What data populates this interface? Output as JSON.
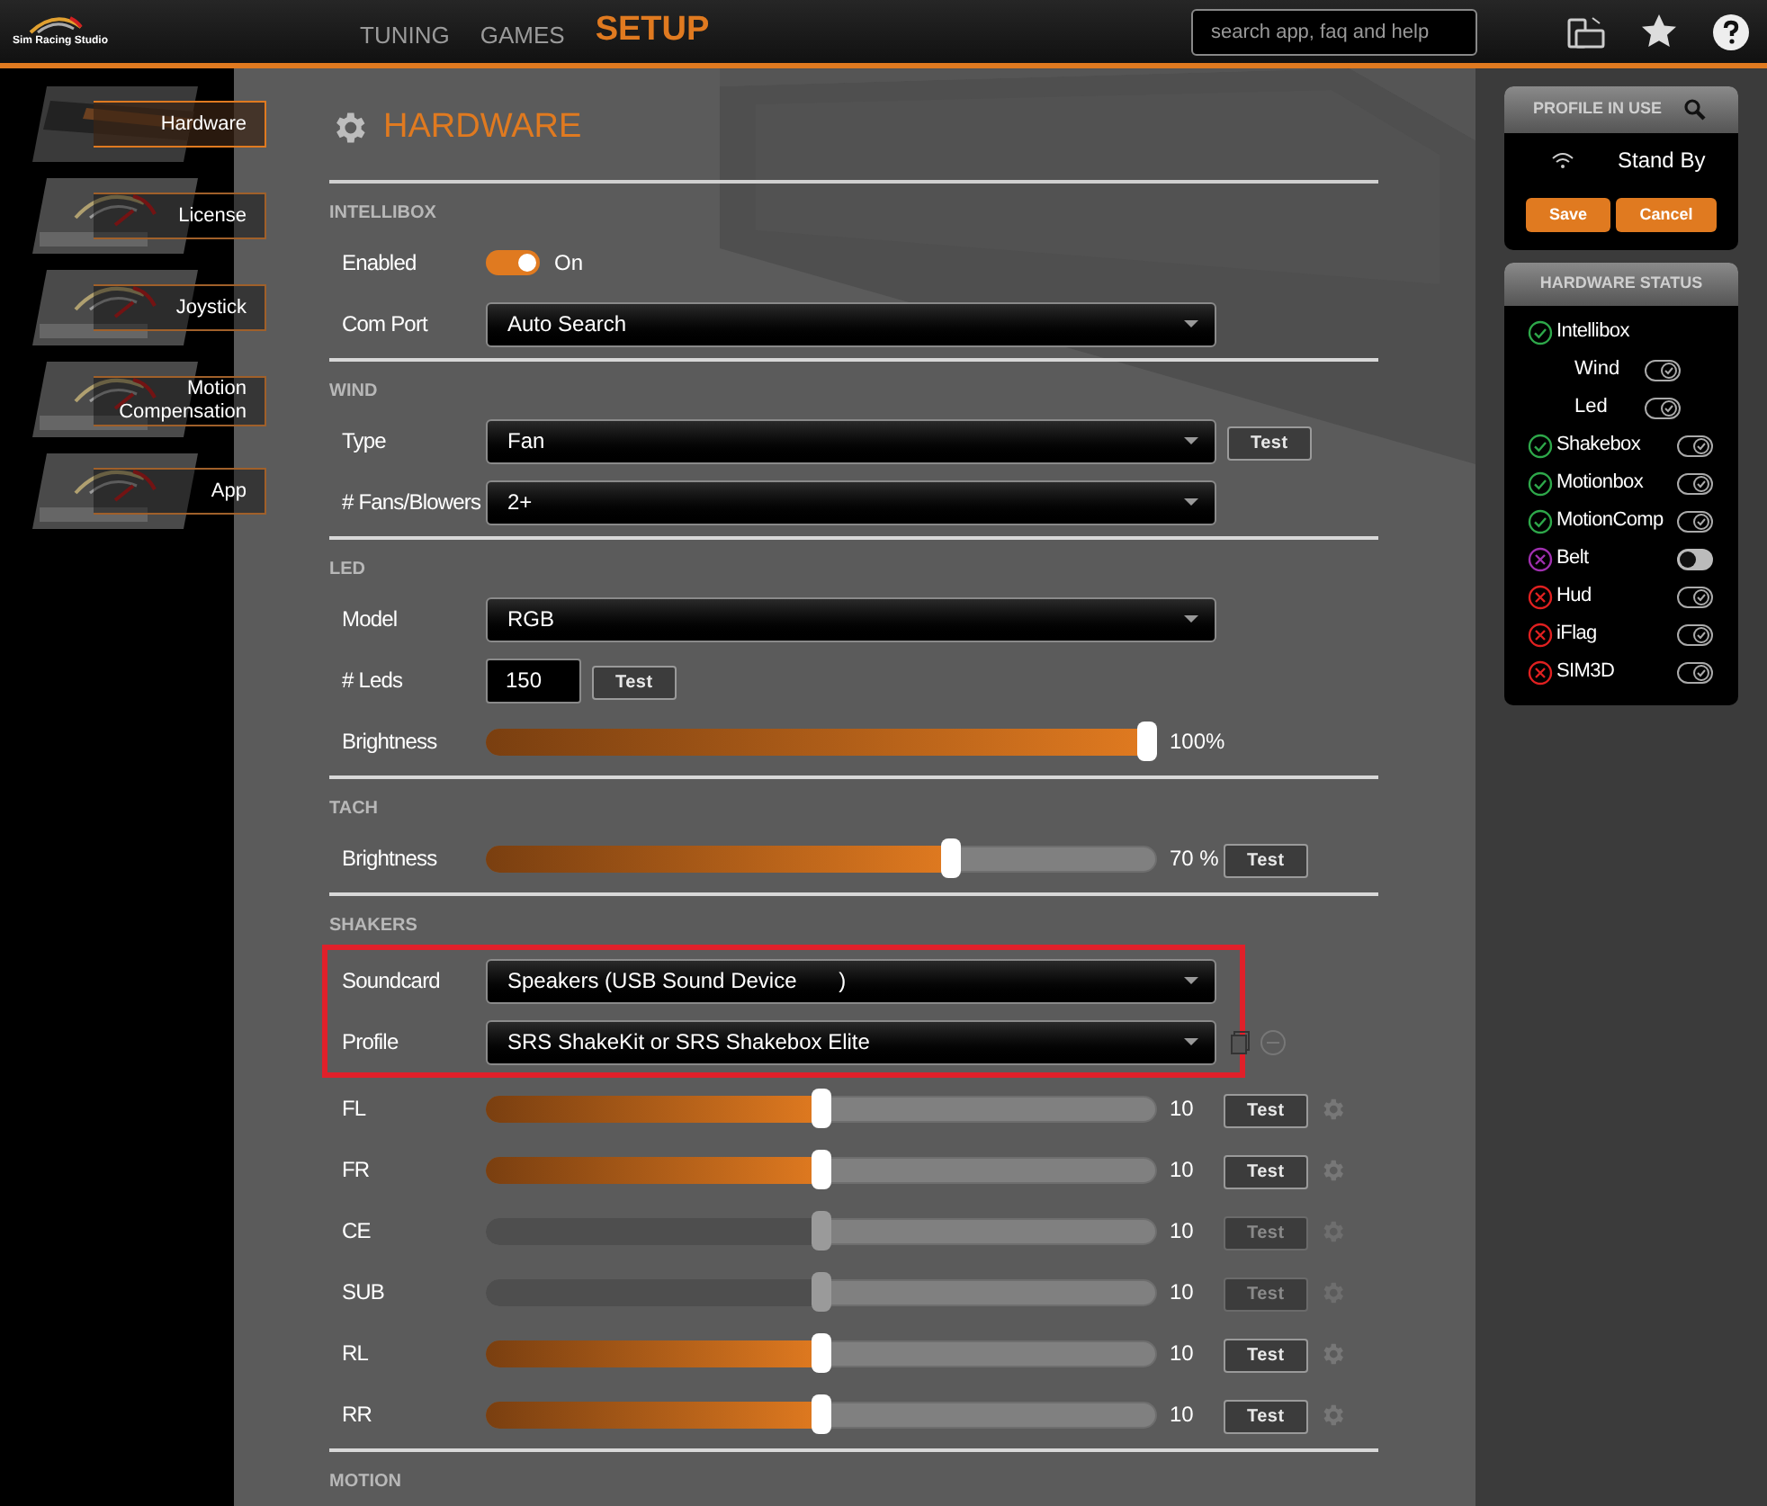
{
  "logo_text": "Sim Racing Studio",
  "nav": [
    {
      "label": "TUNING",
      "selected": false
    },
    {
      "label": "GAMES",
      "selected": false
    },
    {
      "label": "SETUP",
      "selected": true
    }
  ],
  "search": {
    "placeholder": "search app, faq and help"
  },
  "sidebar": {
    "items": [
      {
        "label": "Hardware",
        "selected": true
      },
      {
        "label": "License",
        "selected": false
      },
      {
        "label": "Joystick",
        "selected": false
      },
      {
        "label": "Motion Compensation",
        "selected": false
      },
      {
        "label": "App",
        "selected": false
      }
    ]
  },
  "page_title": "HARDWARE",
  "sections": [
    {
      "title": "INTELLIBOX",
      "rows": [
        {
          "kind": "toggle",
          "label": "Enabled",
          "on": true,
          "value": "On"
        },
        {
          "kind": "select",
          "label": "Com Port",
          "value": "Auto Search"
        }
      ]
    },
    {
      "title": "WIND",
      "rows": [
        {
          "kind": "select",
          "label": "Type",
          "value": "Fan",
          "button": "Test"
        },
        {
          "kind": "select",
          "label": "# Fans/Blowers",
          "value": "2+"
        }
      ]
    },
    {
      "title": "LED",
      "rows": [
        {
          "kind": "select",
          "label": "Model",
          "value": "RGB"
        },
        {
          "kind": "input",
          "label": "# Leds",
          "value": "150",
          "button": "Test"
        },
        {
          "kind": "slider",
          "label": "Brightness",
          "level": 1.0,
          "reading": "100%",
          "disabled": false
        }
      ]
    },
    {
      "title": "TACH",
      "rows": [
        {
          "kind": "slider",
          "label": "Brightness",
          "level": 0.7,
          "reading": "70 %",
          "button": "Test",
          "disabled": false
        }
      ]
    },
    {
      "title": "SHAKERS",
      "rows": [
        {
          "kind": "select",
          "label": "Soundcard",
          "value": "Speakers (USB Sound Device       )",
          "highlighted": true
        },
        {
          "kind": "select",
          "label": "Profile",
          "value": "SRS ShakeKit or SRS Shakebox Elite",
          "highlighted": true,
          "extras": true
        },
        {
          "kind": "slider",
          "label": "FL",
          "level": 0.5,
          "reading": "10",
          "button": "Test",
          "gear": true,
          "disabled": false
        },
        {
          "kind": "slider",
          "label": "FR",
          "level": 0.5,
          "reading": "10",
          "button": "Test",
          "gear": true,
          "disabled": false
        },
        {
          "kind": "slider",
          "label": "CE",
          "level": 0.5,
          "reading": "10",
          "button": "Test",
          "gear": true,
          "disabled": true
        },
        {
          "kind": "slider",
          "label": "SUB",
          "level": 0.5,
          "reading": "10",
          "button": "Test",
          "gear": true,
          "disabled": true
        },
        {
          "kind": "slider",
          "label": "RL",
          "level": 0.5,
          "reading": "10",
          "button": "Test",
          "gear": true,
          "disabled": false
        },
        {
          "kind": "slider",
          "label": "RR",
          "level": 0.5,
          "reading": "10",
          "button": "Test",
          "gear": true,
          "disabled": false
        }
      ]
    },
    {
      "title": "MOTION"
    }
  ],
  "profile_panel": {
    "title": "PROFILE IN USE",
    "status": "Stand By",
    "buttons": [
      "Save",
      "Cancel"
    ]
  },
  "hardware_status": {
    "title": "HARDWARE STATUS",
    "items": [
      {
        "name": "Intellibox",
        "kind": "check",
        "color": "#2ea84a",
        "children": [
          {
            "name": "Wind",
            "on": true
          },
          {
            "name": "Led",
            "on": true
          }
        ]
      },
      {
        "name": "Shakebox",
        "kind": "check",
        "color": "#2ea84a",
        "on": true
      },
      {
        "name": "Motionbox",
        "kind": "check",
        "color": "#2ea84a",
        "on": true
      },
      {
        "name": "MotionComp",
        "kind": "check",
        "color": "#2ea84a",
        "on": true
      },
      {
        "name": "Belt",
        "kind": "cross",
        "color": "#a030b0",
        "on": false
      },
      {
        "name": "Hud",
        "kind": "cross",
        "color": "#e02020",
        "on": true
      },
      {
        "name": "iFlag",
        "kind": "cross",
        "color": "#e02020",
        "on": true
      },
      {
        "name": "SIM3D",
        "kind": "cross",
        "color": "#e02020",
        "on": true
      }
    ]
  }
}
